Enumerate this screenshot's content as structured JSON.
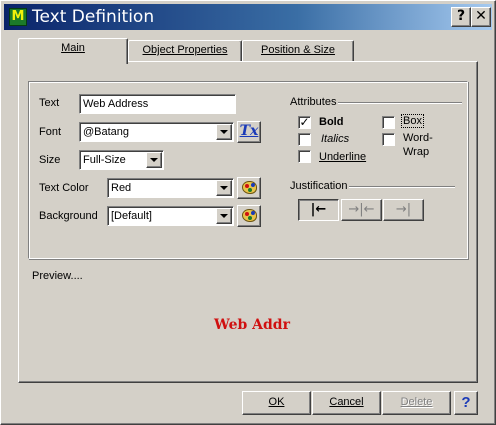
{
  "window": {
    "title": "Text Definition"
  },
  "titlebar": {
    "help_glyph": "?",
    "close_glyph": "✕"
  },
  "tabs": [
    {
      "label": "Main",
      "active": true
    },
    {
      "label": "Object Properties",
      "active": false
    },
    {
      "label": "Position & Size",
      "active": false
    }
  ],
  "fields": {
    "text": {
      "label": "Text",
      "value": "Web Address"
    },
    "font": {
      "label": "Font",
      "value": "@Batang",
      "tx_glyph": "Tx"
    },
    "size": {
      "label": "Size",
      "value": "Full-Size"
    },
    "text_color": {
      "label": "Text Color",
      "value": "Red"
    },
    "background": {
      "label": "Background",
      "value": "[Default]"
    }
  },
  "attributes": {
    "title": "Attributes",
    "bold": {
      "label": "Bold",
      "checked": true
    },
    "italics": {
      "label": "Italics",
      "checked": false
    },
    "underline": {
      "label": "Underline",
      "checked": false
    },
    "box": {
      "label": "Box",
      "checked": false
    },
    "word_wrap": {
      "label_line1": "Word-",
      "label_line2": "Wrap",
      "checked": false
    }
  },
  "justification": {
    "title": "Justification",
    "left_glyph": "|←",
    "center_glyph": "→|←",
    "right_glyph": "→|",
    "selected": "left"
  },
  "preview": {
    "label": "Preview....",
    "text": "Web Addr",
    "color": "#d01010"
  },
  "buttons": {
    "ok": "OK",
    "cancel": "Cancel",
    "delete": "Delete",
    "help": "?"
  },
  "colors": {
    "title_start": "#0a246a",
    "title_end": "#a6caf0",
    "face": "#d4d0c8"
  }
}
